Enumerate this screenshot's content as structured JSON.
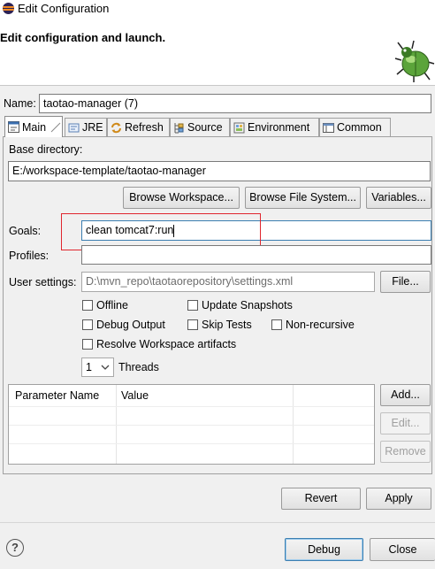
{
  "window": {
    "title": "Edit Configuration",
    "icon": "eclipse-icon"
  },
  "header": {
    "heading": "Edit configuration and launch.",
    "icon": "bug-icon"
  },
  "name": {
    "label": "Name:",
    "value": "taotao-manager (7)"
  },
  "tabs": [
    {
      "label": "Main",
      "icon": "maven-main-icon",
      "active": true
    },
    {
      "label": "JRE",
      "icon": "jre-icon",
      "active": false
    },
    {
      "label": "Refresh",
      "icon": "refresh-icon",
      "active": false
    },
    {
      "label": "Source",
      "icon": "source-icon",
      "active": false
    },
    {
      "label": "Environment",
      "icon": "environment-icon",
      "active": false
    },
    {
      "label": "Common",
      "icon": "common-icon",
      "active": false
    }
  ],
  "main": {
    "base_dir_label": "Base directory:",
    "base_dir_value": "E:/workspace-template/taotao-manager",
    "browse_workspace": "Browse Workspace...",
    "browse_filesystem": "Browse File System...",
    "variables": "Variables...",
    "goals_label": "Goals:",
    "goals_value": "clean tomcat7:run",
    "profiles_label": "Profiles:",
    "profiles_value": "",
    "user_settings_label": "User settings:",
    "user_settings_value": "D:\\mvn_repo\\taotaorepository\\settings.xml",
    "file_button": "File...",
    "checkboxes": {
      "offline": "Offline",
      "update_snapshots": "Update Snapshots",
      "debug_output": "Debug Output",
      "skip_tests": "Skip Tests",
      "non_recursive": "Non-recursive",
      "resolve_workspace": "Resolve Workspace artifacts"
    },
    "threads_value": "1",
    "threads_label": "Threads",
    "table": {
      "columns": [
        "Parameter Name",
        "Value"
      ]
    },
    "add_button": "Add...",
    "edit_button": "Edit...",
    "remove_button": "Remove"
  },
  "footer": {
    "revert": "Revert",
    "apply": "Apply",
    "debug": "Debug",
    "close": "Close",
    "help_glyph": "?"
  },
  "colors": {
    "highlight_box": "#e0262e",
    "focus_border": "#3c7fb1"
  }
}
